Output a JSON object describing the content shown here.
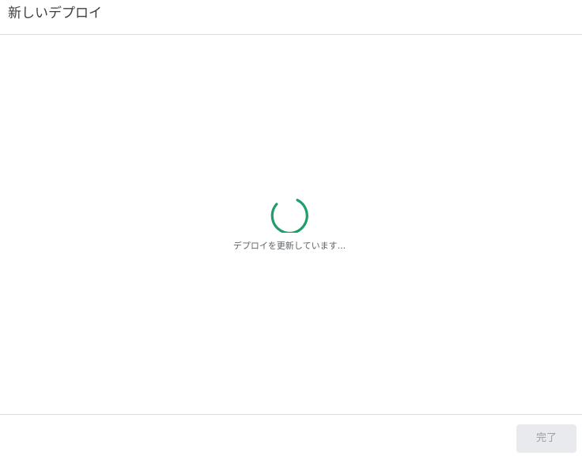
{
  "dialog": {
    "title": "新しいデプロイ",
    "status_text": "デプロイを更新しています...",
    "spinner_icon": "loading-spinner-icon",
    "spinner_color": "#1e9e6a",
    "done_label": "完了",
    "done_enabled": false
  }
}
